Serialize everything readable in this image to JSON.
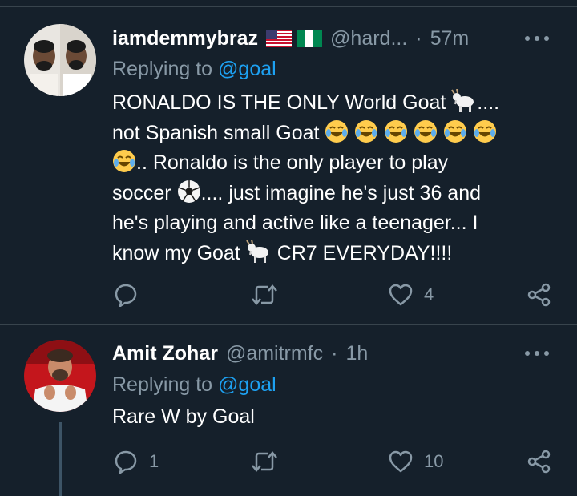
{
  "tweets": [
    {
      "author_name": "iamdemmybraz",
      "flags": [
        "us-flag",
        "nigeria-flag"
      ],
      "handle": "@hard...",
      "separator": "·",
      "time": "57m",
      "replying_prefix": "Replying to ",
      "replying_to": "@goal",
      "text_lines": [
        "RONALDO IS THE ONLY World Goat",
        "....",
        "not Spanish small Goat",
        ".. Ronaldo is the only player to play",
        "soccer",
        ".... just imagine he's just 36 and",
        "he's playing and active like a teenager... I",
        "know my Goat",
        "CR7 EVERYDAY!!!!"
      ],
      "reply_count": "",
      "retweet_count": "",
      "like_count": "4"
    },
    {
      "author_name": "Amit Zohar",
      "handle": "@amitrmfc",
      "separator": "·",
      "time": "1h",
      "replying_prefix": "Replying to ",
      "replying_to": "@goal",
      "text": "Rare W by Goal",
      "reply_count": "1",
      "retweet_count": "",
      "like_count": "10"
    }
  ],
  "colors": {
    "background": "#15202b",
    "secondary_text": "#8899a6",
    "mention": "#1da1f2",
    "divider": "#38444d"
  },
  "icons": [
    "reply-icon",
    "retweet-icon",
    "like-icon",
    "share-icon",
    "more-icon",
    "goat-emoji",
    "laughing-emoji",
    "soccer-ball-emoji"
  ]
}
